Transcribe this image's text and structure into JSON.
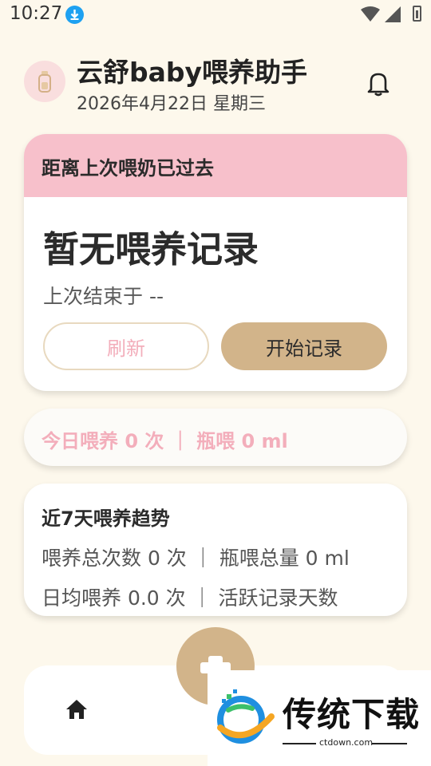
{
  "status_bar": {
    "time": "10:27"
  },
  "header": {
    "title": "云舒baby喂养助手",
    "date": "2026年4月22日 星期三"
  },
  "feed_card": {
    "header_label": "距离上次喂奶已过去",
    "main_text": "暂无喂养记录",
    "sub_text": "上次结束于 --",
    "refresh_label": "刷新",
    "start_label": "开始记录"
  },
  "today_card": {
    "summary": "今日喂养 0 次 ｜ 瓶喂 0 ml"
  },
  "trend_card": {
    "title": "近7天喂养趋势",
    "line1": "喂养总次数 0 次 ｜ 瓶喂总量 0 ml",
    "line2": "日均喂养 0.0 次 ｜ 活跃记录天数"
  },
  "watermark": {
    "name": "传统下载",
    "url": "ctdown.com"
  },
  "colors": {
    "background": "#fdf8ec",
    "accent_pink": "#f7c0cb",
    "accent_tan": "#d2b48a",
    "pink_text": "#f3aebb"
  },
  "icons": [
    "download-icon",
    "wifi-icon",
    "signal-icon",
    "battery-icon",
    "bottle-icon",
    "bell-icon",
    "plus-icon",
    "home-icon"
  ]
}
